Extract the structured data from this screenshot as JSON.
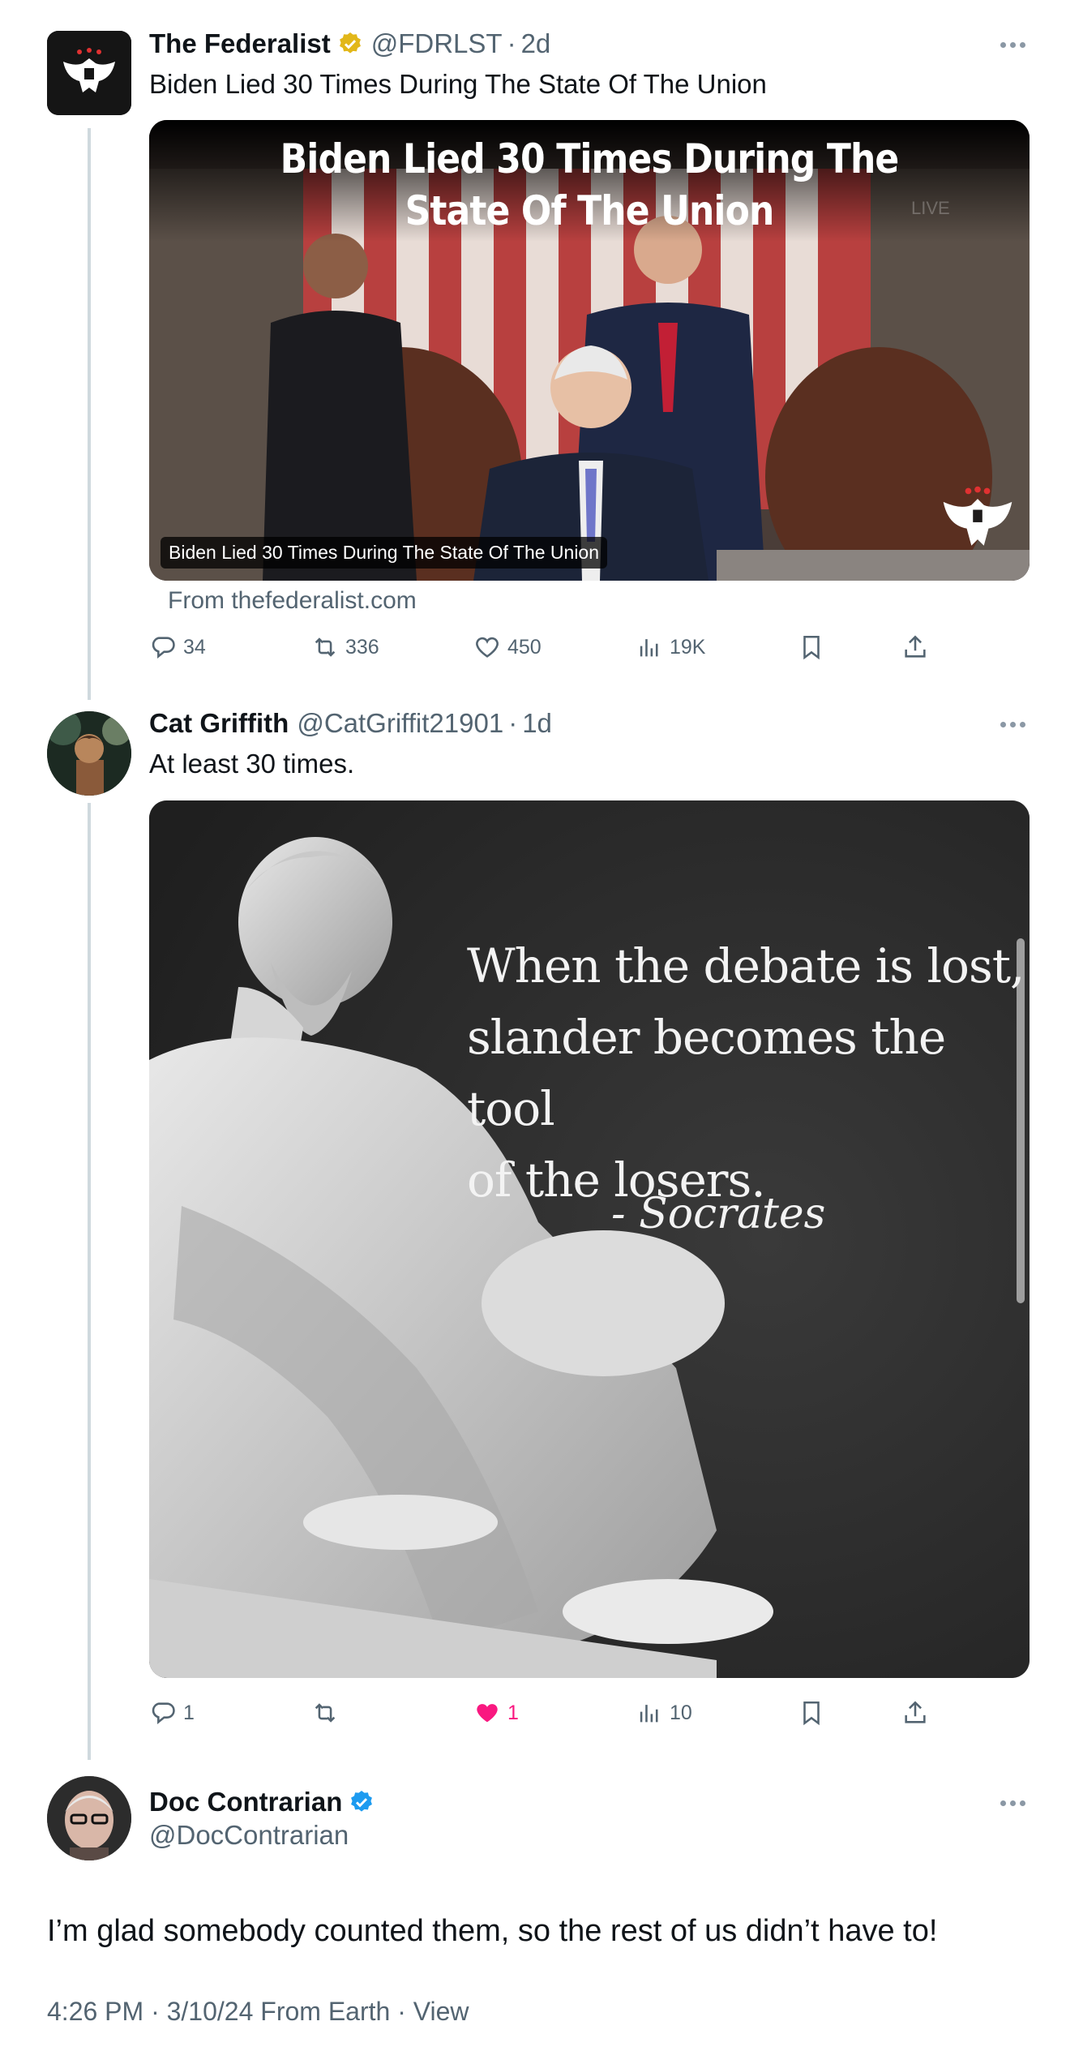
{
  "tweet1": {
    "name": "The Federalist",
    "handle": "@FDRLST",
    "sep": "·",
    "time": "2d",
    "text": "Biden Lied 30 Times During The State Of The Union",
    "card": {
      "headline": "Biden Lied 30 Times During The State Of The Union",
      "caption": "Biden Lied 30 Times During The State Of The Union",
      "watermark": "LIVE",
      "source": "From thefederalist.com"
    },
    "stats": {
      "replies": "34",
      "reposts": "336",
      "likes": "450",
      "views": "19K"
    },
    "verified_color": "#e2b719"
  },
  "tweet2": {
    "name": "Cat Griffith",
    "handle": "@CatGriffit21901",
    "sep": "·",
    "time": "1d",
    "text": "At least 30 times.",
    "image": {
      "quote_line1": "When the debate is lost,",
      "quote_line2": "slander becomes the tool",
      "quote_line3": "of the losers.",
      "attribution": "- Socrates"
    },
    "stats": {
      "replies": "1",
      "reposts": "",
      "likes": "1",
      "views": "10"
    },
    "like_color": "#f91880"
  },
  "tweet3": {
    "name": "Doc Contrarian",
    "handle": "@DocContrarian",
    "text": "I’m glad somebody counted them, so the rest of us didn’t have to!",
    "footer": "4:26 PM · 3/10/24 From Earth · View",
    "verified_color": "#1d9bf0"
  },
  "icons": [
    "eagle-logo-icon",
    "verified-badge-icon",
    "more-icon",
    "reply-icon",
    "repost-icon",
    "like-icon",
    "views-icon",
    "bookmark-icon",
    "share-icon"
  ]
}
